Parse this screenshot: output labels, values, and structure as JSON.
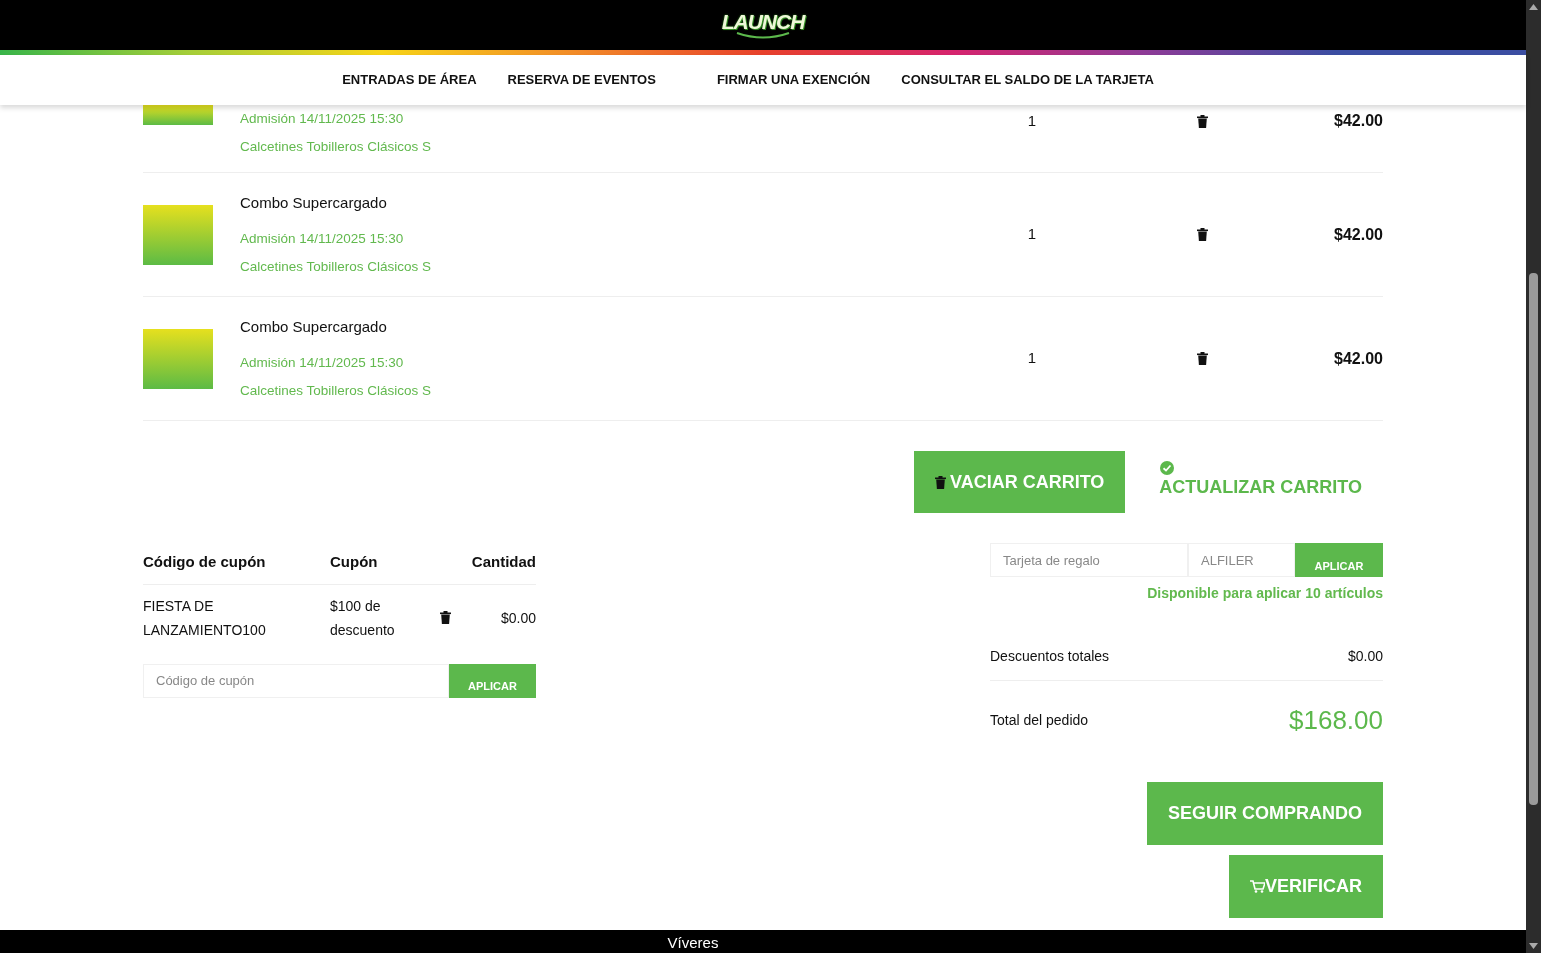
{
  "header": {
    "logo": "LAUNCH"
  },
  "nav": [
    {
      "label": "ENTRADAS DE ÁREA"
    },
    {
      "label": "RESERVA DE EVENTOS"
    },
    {
      "label": "FIRMAR UNA EXENCIÓN"
    },
    {
      "label": "CONSULTAR EL SALDO DE LA TARJETA"
    }
  ],
  "cart_items": [
    {
      "details": [
        "Admisión 14/11/2025 15:30",
        "Calcetines Tobilleros Clásicos S"
      ],
      "quantity": "1",
      "price": "$42.00"
    },
    {
      "title": "Combo Supercargado",
      "details": [
        "Admisión 14/11/2025 15:30",
        "Calcetines Tobilleros Clásicos S"
      ],
      "quantity": "1",
      "price": "$42.00"
    },
    {
      "title": "Combo Supercargado",
      "details": [
        "Admisión 14/11/2025 15:30",
        "Calcetines Tobilleros Clásicos S"
      ],
      "quantity": "1",
      "price": "$42.00"
    }
  ],
  "cart_actions": {
    "clear": "VACIAR CARRITO",
    "update": "ACTUALIZAR CARRITO"
  },
  "coupons": {
    "columns": [
      "Código de cupón",
      "Cupón",
      "Cantidad"
    ],
    "rows": [
      {
        "code": "FIESTA DE LANZAMIENTO100",
        "coupon": "$100 de descuento",
        "amount": "$0.00"
      }
    ],
    "input": {
      "placeholder": "Código de cupón"
    },
    "apply": "APLICAR"
  },
  "gift_card": {
    "card_field": {
      "placeholder": "Tarjeta de regalo"
    },
    "pin_field": {
      "placeholder": "ALFILER"
    },
    "apply": "APLICAR",
    "note": "Disponible para aplicar **10** artículos"
  },
  "totals": [
    {
      "label": "Descuentos totales",
      "value": "$0.00",
      "kind": "discount"
    },
    {
      "label": "Total del pedido",
      "value": "$168.00",
      "kind": "grand"
    }
  ],
  "buttons": {
    "continue": "SEGUIR COMPRANDO",
    "checkout": "VERIFICAR"
  },
  "footer": {
    "text": "Víveres"
  }
}
